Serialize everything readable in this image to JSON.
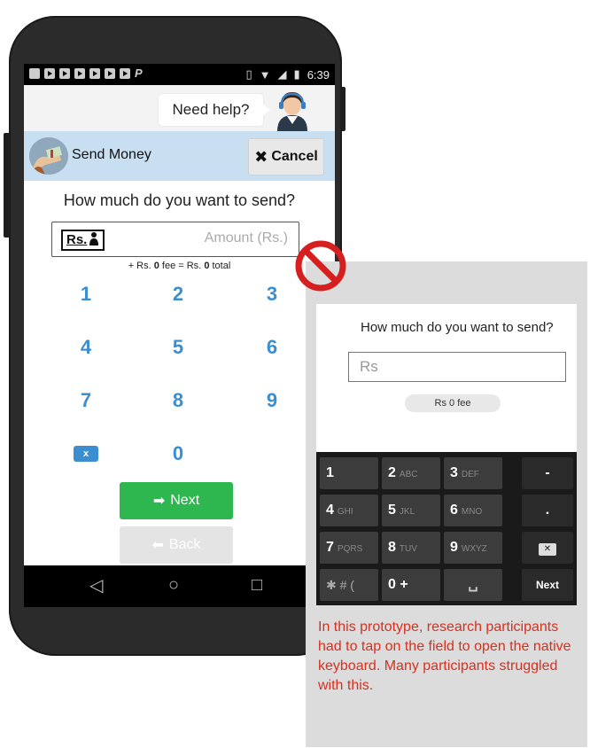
{
  "status_bar": {
    "time": "6:39"
  },
  "help": {
    "label": "Need help?"
  },
  "title_bar": {
    "title": "Send Money",
    "cancel_label": "Cancel"
  },
  "form": {
    "question": "How much do you want to send?",
    "currency_badge": "Rs.",
    "amount_placeholder": "Amount (Rs.)",
    "fee_prefix": "+ Rs. ",
    "fee_value": "0",
    "fee_middle": " fee = Rs. ",
    "total_value": "0",
    "fee_suffix": " total"
  },
  "keypad": {
    "keys": [
      "1",
      "2",
      "3",
      "4",
      "5",
      "6",
      "7",
      "8",
      "9",
      "0"
    ],
    "backspace_label": "x"
  },
  "buttons": {
    "next_label": "Next",
    "back_label": "Back"
  },
  "callout": {
    "question": "How much do you want to send?",
    "field_value": "Rs",
    "fee_pill": "Rs 0 fee",
    "keyboard": {
      "row1": [
        [
          "1",
          ""
        ],
        [
          "2",
          "ABC"
        ],
        [
          "3",
          "DEF"
        ],
        [
          "-",
          ""
        ]
      ],
      "row2": [
        [
          "4",
          "GHI"
        ],
        [
          "5",
          "JKL"
        ],
        [
          "6",
          "MNO"
        ],
        [
          ".",
          ""
        ]
      ],
      "row3": [
        [
          "7",
          "PQRS"
        ],
        [
          "8",
          "TUV"
        ],
        [
          "9",
          "WXYZ"
        ]
      ],
      "row4_sym": "✱ # (",
      "row4_zero": "0 +",
      "next_label": "Next"
    },
    "caption": "In this prototype, research participants had to tap on the field to open the native keyboard. Many participants struggled with this."
  },
  "colors": {
    "accent_blue": "#3b8fd0",
    "next_green": "#2eb64f",
    "title_bar_bg": "#c7dff0",
    "caption_red": "#d6301f",
    "no_sign_red": "#d61f1f"
  }
}
